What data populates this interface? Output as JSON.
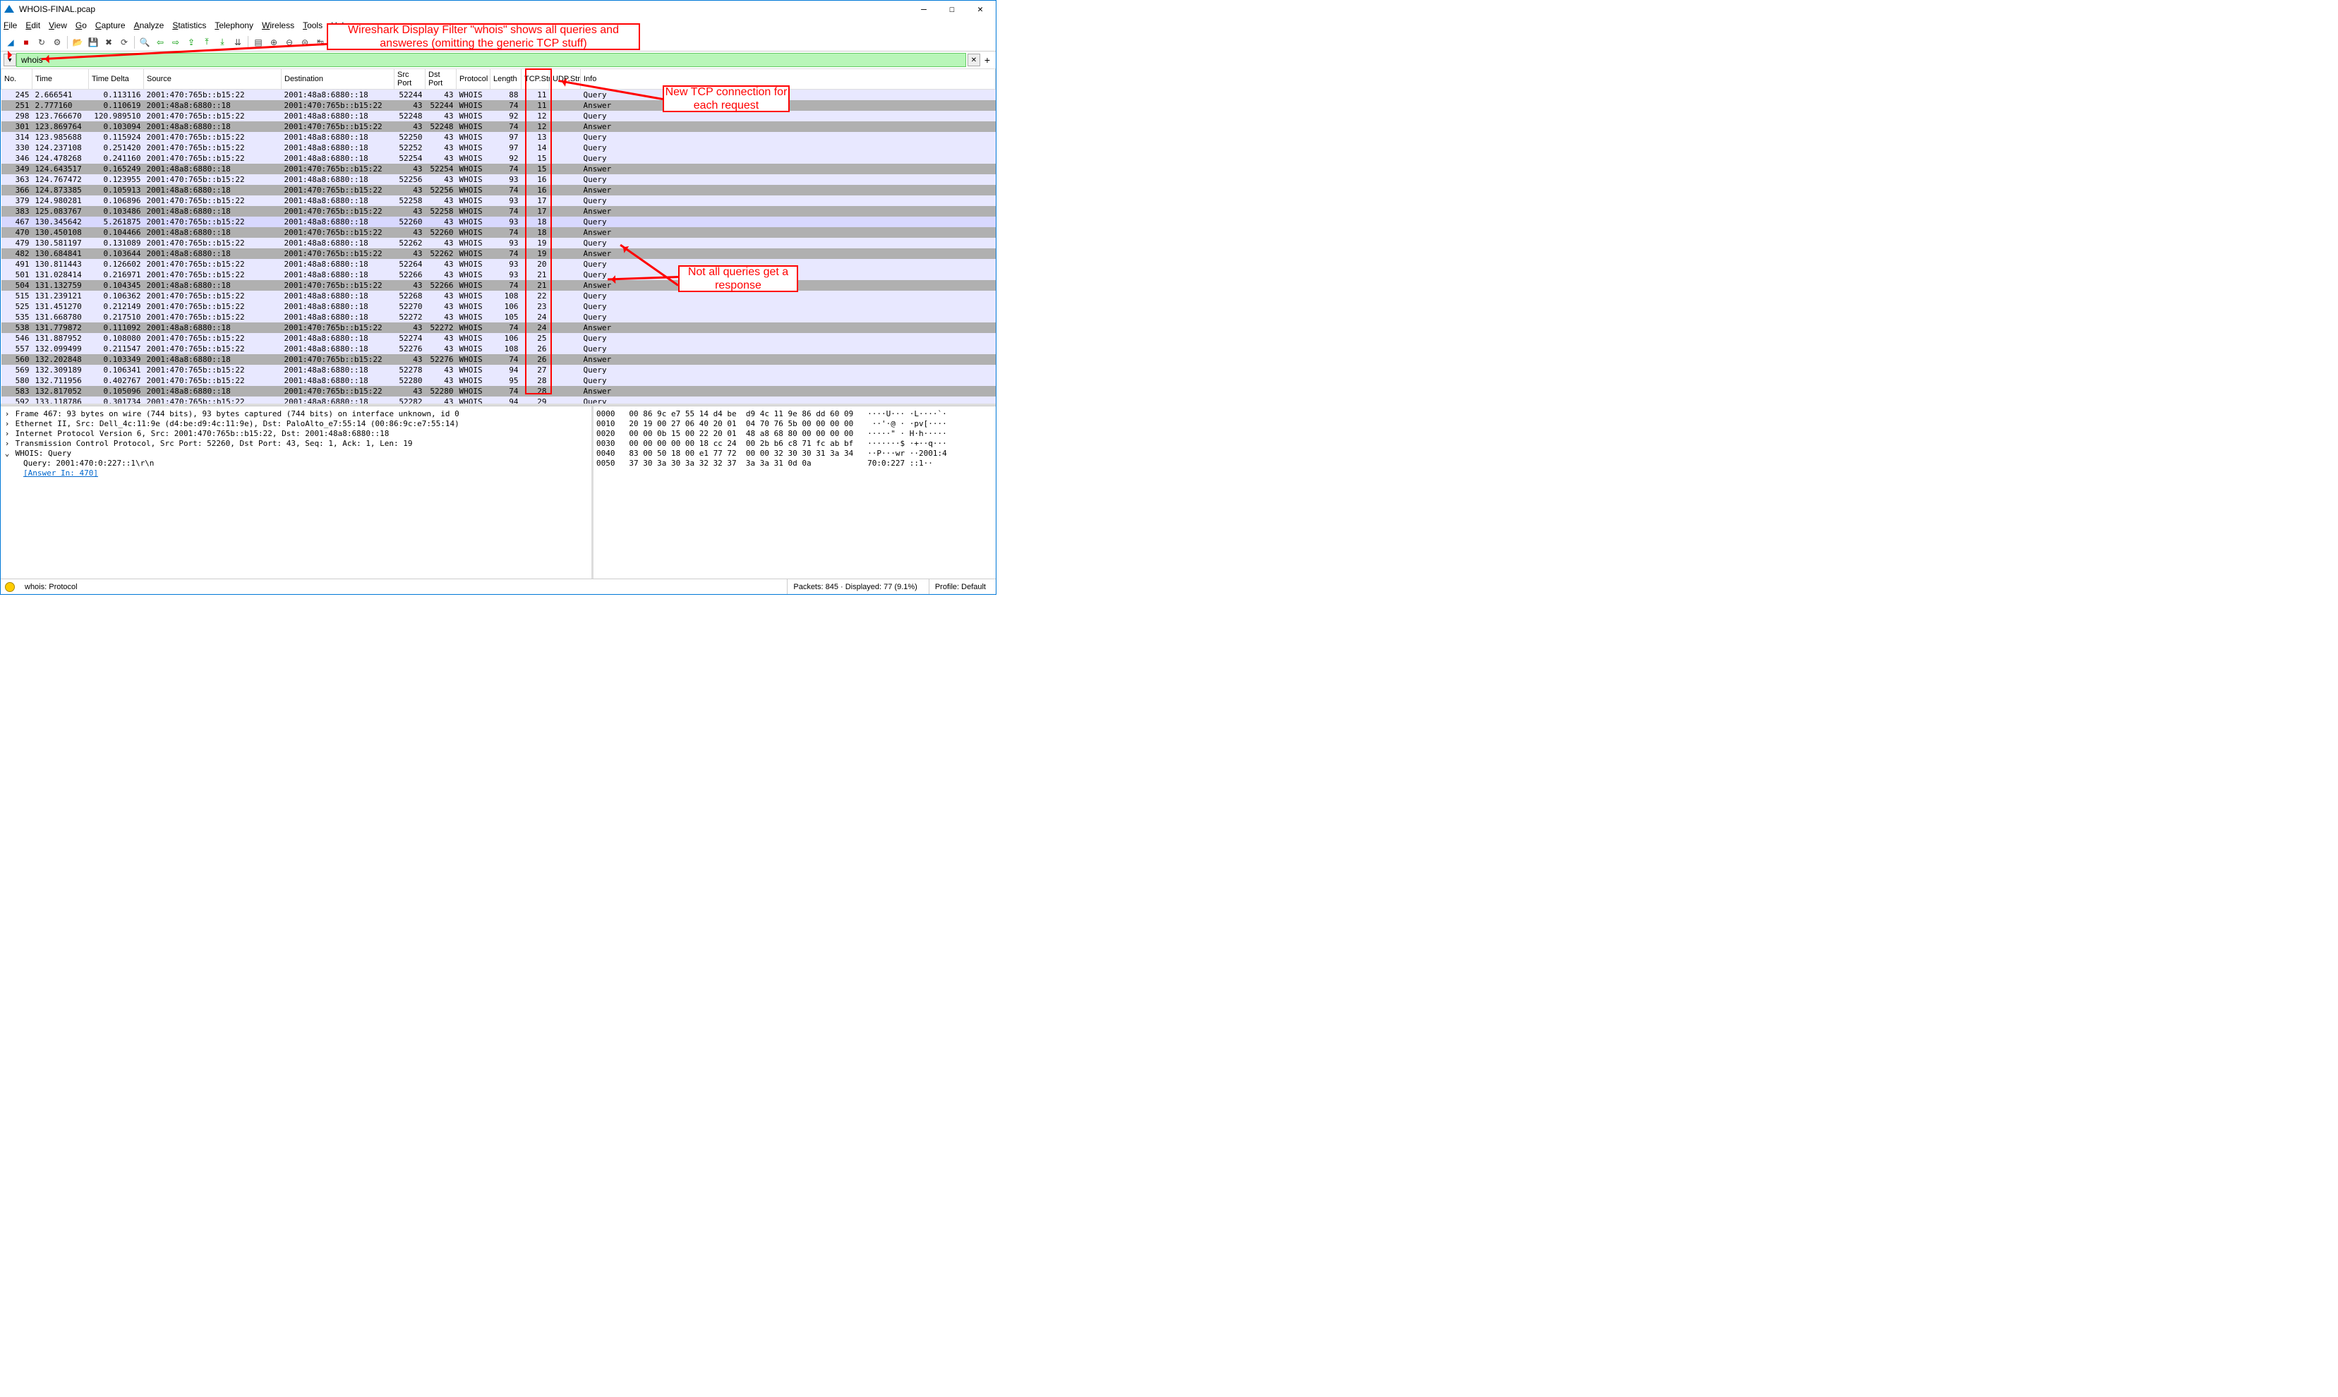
{
  "window": {
    "title": "WHOIS-FINAL.pcap"
  },
  "menu": [
    "File",
    "Edit",
    "View",
    "Go",
    "Capture",
    "Analyze",
    "Statistics",
    "Telephony",
    "Wireless",
    "Tools",
    "Help"
  ],
  "filter": {
    "value": "whois"
  },
  "columns": [
    "No.",
    "Time",
    "Time Delta",
    "Source",
    "Destination",
    "Src Port",
    "Dst Port",
    "Protocol",
    "Length",
    "TCP.Str",
    "UDP.Str",
    "Info"
  ],
  "rows": [
    {
      "no": "245",
      "time": "2.666541",
      "delta": "0.113116",
      "src": "2001:470:765b::b15:22",
      "dst": "2001:48a8:6880::18",
      "sp": "52244",
      "dp": "43",
      "proto": "WHOIS",
      "len": "88",
      "tcp": "11",
      "info": "Query",
      "type": "q"
    },
    {
      "no": "251",
      "time": "2.777160",
      "delta": "0.110619",
      "src": "2001:48a8:6880::18",
      "dst": "2001:470:765b::b15:22",
      "sp": "43",
      "dp": "52244",
      "proto": "WHOIS",
      "len": "74",
      "tcp": "11",
      "info": "Answer",
      "type": "a"
    },
    {
      "no": "298",
      "time": "123.766670",
      "delta": "120.989510",
      "src": "2001:470:765b::b15:22",
      "dst": "2001:48a8:6880::18",
      "sp": "52248",
      "dp": "43",
      "proto": "WHOIS",
      "len": "92",
      "tcp": "12",
      "info": "Query",
      "type": "q"
    },
    {
      "no": "301",
      "time": "123.869764",
      "delta": "0.103094",
      "src": "2001:48a8:6880::18",
      "dst": "2001:470:765b::b15:22",
      "sp": "43",
      "dp": "52248",
      "proto": "WHOIS",
      "len": "74",
      "tcp": "12",
      "info": "Answer",
      "type": "a"
    },
    {
      "no": "314",
      "time": "123.985688",
      "delta": "0.115924",
      "src": "2001:470:765b::b15:22",
      "dst": "2001:48a8:6880::18",
      "sp": "52250",
      "dp": "43",
      "proto": "WHOIS",
      "len": "97",
      "tcp": "13",
      "info": "Query",
      "type": "q"
    },
    {
      "no": "330",
      "time": "124.237108",
      "delta": "0.251420",
      "src": "2001:470:765b::b15:22",
      "dst": "2001:48a8:6880::18",
      "sp": "52252",
      "dp": "43",
      "proto": "WHOIS",
      "len": "97",
      "tcp": "14",
      "info": "Query",
      "type": "q"
    },
    {
      "no": "346",
      "time": "124.478268",
      "delta": "0.241160",
      "src": "2001:470:765b::b15:22",
      "dst": "2001:48a8:6880::18",
      "sp": "52254",
      "dp": "43",
      "proto": "WHOIS",
      "len": "92",
      "tcp": "15",
      "info": "Query",
      "type": "q"
    },
    {
      "no": "349",
      "time": "124.643517",
      "delta": "0.165249",
      "src": "2001:48a8:6880::18",
      "dst": "2001:470:765b::b15:22",
      "sp": "43",
      "dp": "52254",
      "proto": "WHOIS",
      "len": "74",
      "tcp": "15",
      "info": "Answer",
      "type": "a"
    },
    {
      "no": "363",
      "time": "124.767472",
      "delta": "0.123955",
      "src": "2001:470:765b::b15:22",
      "dst": "2001:48a8:6880::18",
      "sp": "52256",
      "dp": "43",
      "proto": "WHOIS",
      "len": "93",
      "tcp": "16",
      "info": "Query",
      "type": "q"
    },
    {
      "no": "366",
      "time": "124.873385",
      "delta": "0.105913",
      "src": "2001:48a8:6880::18",
      "dst": "2001:470:765b::b15:22",
      "sp": "43",
      "dp": "52256",
      "proto": "WHOIS",
      "len": "74",
      "tcp": "16",
      "info": "Answer",
      "type": "a"
    },
    {
      "no": "379",
      "time": "124.980281",
      "delta": "0.106896",
      "src": "2001:470:765b::b15:22",
      "dst": "2001:48a8:6880::18",
      "sp": "52258",
      "dp": "43",
      "proto": "WHOIS",
      "len": "93",
      "tcp": "17",
      "info": "Query",
      "type": "q"
    },
    {
      "no": "383",
      "time": "125.083767",
      "delta": "0.103486",
      "src": "2001:48a8:6880::18",
      "dst": "2001:470:765b::b15:22",
      "sp": "43",
      "dp": "52258",
      "proto": "WHOIS",
      "len": "74",
      "tcp": "17",
      "info": "Answer",
      "type": "a"
    },
    {
      "no": "467",
      "time": "130.345642",
      "delta": "5.261875",
      "src": "2001:470:765b::b15:22",
      "dst": "2001:48a8:6880::18",
      "sp": "52260",
      "dp": "43",
      "proto": "WHOIS",
      "len": "93",
      "tcp": "18",
      "info": "Query",
      "type": "sel"
    },
    {
      "no": "470",
      "time": "130.450108",
      "delta": "0.104466",
      "src": "2001:48a8:6880::18",
      "dst": "2001:470:765b::b15:22",
      "sp": "43",
      "dp": "52260",
      "proto": "WHOIS",
      "len": "74",
      "tcp": "18",
      "info": "Answer",
      "type": "a"
    },
    {
      "no": "479",
      "time": "130.581197",
      "delta": "0.131089",
      "src": "2001:470:765b::b15:22",
      "dst": "2001:48a8:6880::18",
      "sp": "52262",
      "dp": "43",
      "proto": "WHOIS",
      "len": "93",
      "tcp": "19",
      "info": "Query",
      "type": "q"
    },
    {
      "no": "482",
      "time": "130.684841",
      "delta": "0.103644",
      "src": "2001:48a8:6880::18",
      "dst": "2001:470:765b::b15:22",
      "sp": "43",
      "dp": "52262",
      "proto": "WHOIS",
      "len": "74",
      "tcp": "19",
      "info": "Answer",
      "type": "a"
    },
    {
      "no": "491",
      "time": "130.811443",
      "delta": "0.126602",
      "src": "2001:470:765b::b15:22",
      "dst": "2001:48a8:6880::18",
      "sp": "52264",
      "dp": "43",
      "proto": "WHOIS",
      "len": "93",
      "tcp": "20",
      "info": "Query",
      "type": "q"
    },
    {
      "no": "501",
      "time": "131.028414",
      "delta": "0.216971",
      "src": "2001:470:765b::b15:22",
      "dst": "2001:48a8:6880::18",
      "sp": "52266",
      "dp": "43",
      "proto": "WHOIS",
      "len": "93",
      "tcp": "21",
      "info": "Query",
      "type": "q"
    },
    {
      "no": "504",
      "time": "131.132759",
      "delta": "0.104345",
      "src": "2001:48a8:6880::18",
      "dst": "2001:470:765b::b15:22",
      "sp": "43",
      "dp": "52266",
      "proto": "WHOIS",
      "len": "74",
      "tcp": "21",
      "info": "Answer",
      "type": "a"
    },
    {
      "no": "515",
      "time": "131.239121",
      "delta": "0.106362",
      "src": "2001:470:765b::b15:22",
      "dst": "2001:48a8:6880::18",
      "sp": "52268",
      "dp": "43",
      "proto": "WHOIS",
      "len": "108",
      "tcp": "22",
      "info": "Query",
      "type": "q"
    },
    {
      "no": "525",
      "time": "131.451270",
      "delta": "0.212149",
      "src": "2001:470:765b::b15:22",
      "dst": "2001:48a8:6880::18",
      "sp": "52270",
      "dp": "43",
      "proto": "WHOIS",
      "len": "106",
      "tcp": "23",
      "info": "Query",
      "type": "q"
    },
    {
      "no": "535",
      "time": "131.668780",
      "delta": "0.217510",
      "src": "2001:470:765b::b15:22",
      "dst": "2001:48a8:6880::18",
      "sp": "52272",
      "dp": "43",
      "proto": "WHOIS",
      "len": "105",
      "tcp": "24",
      "info": "Query",
      "type": "q"
    },
    {
      "no": "538",
      "time": "131.779872",
      "delta": "0.111092",
      "src": "2001:48a8:6880::18",
      "dst": "2001:470:765b::b15:22",
      "sp": "43",
      "dp": "52272",
      "proto": "WHOIS",
      "len": "74",
      "tcp": "24",
      "info": "Answer",
      "type": "a"
    },
    {
      "no": "546",
      "time": "131.887952",
      "delta": "0.108080",
      "src": "2001:470:765b::b15:22",
      "dst": "2001:48a8:6880::18",
      "sp": "52274",
      "dp": "43",
      "proto": "WHOIS",
      "len": "106",
      "tcp": "25",
      "info": "Query",
      "type": "q"
    },
    {
      "no": "557",
      "time": "132.099499",
      "delta": "0.211547",
      "src": "2001:470:765b::b15:22",
      "dst": "2001:48a8:6880::18",
      "sp": "52276",
      "dp": "43",
      "proto": "WHOIS",
      "len": "108",
      "tcp": "26",
      "info": "Query",
      "type": "q"
    },
    {
      "no": "560",
      "time": "132.202848",
      "delta": "0.103349",
      "src": "2001:48a8:6880::18",
      "dst": "2001:470:765b::b15:22",
      "sp": "43",
      "dp": "52276",
      "proto": "WHOIS",
      "len": "74",
      "tcp": "26",
      "info": "Answer",
      "type": "a"
    },
    {
      "no": "569",
      "time": "132.309189",
      "delta": "0.106341",
      "src": "2001:470:765b::b15:22",
      "dst": "2001:48a8:6880::18",
      "sp": "52278",
      "dp": "43",
      "proto": "WHOIS",
      "len": "94",
      "tcp": "27",
      "info": "Query",
      "type": "q"
    },
    {
      "no": "580",
      "time": "132.711956",
      "delta": "0.402767",
      "src": "2001:470:765b::b15:22",
      "dst": "2001:48a8:6880::18",
      "sp": "52280",
      "dp": "43",
      "proto": "WHOIS",
      "len": "95",
      "tcp": "28",
      "info": "Query",
      "type": "q"
    },
    {
      "no": "583",
      "time": "132.817052",
      "delta": "0.105096",
      "src": "2001:48a8:6880::18",
      "dst": "2001:470:765b::b15:22",
      "sp": "43",
      "dp": "52280",
      "proto": "WHOIS",
      "len": "74",
      "tcp": "28",
      "info": "Answer",
      "type": "a"
    },
    {
      "no": "592",
      "time": "133.118786",
      "delta": "0.301734",
      "src": "2001:470:765b::b15:22",
      "dst": "2001:48a8:6880::18",
      "sp": "52282",
      "dp": "43",
      "proto": "WHOIS",
      "len": "94",
      "tcp": "29",
      "info": "Query",
      "type": "q"
    }
  ],
  "tree": [
    {
      "toggle": ">",
      "text": "Frame 467: 93 bytes on wire (744 bits), 93 bytes captured (744 bits) on interface unknown, id 0"
    },
    {
      "toggle": ">",
      "text": "Ethernet II, Src: Dell_4c:11:9e (d4:be:d9:4c:11:9e), Dst: PaloAlto_e7:55:14 (00:86:9c:e7:55:14)"
    },
    {
      "toggle": ">",
      "text": "Internet Protocol Version 6, Src: 2001:470:765b::b15:22, Dst: 2001:48a8:6880::18"
    },
    {
      "toggle": ">",
      "text": "Transmission Control Protocol, Src Port: 52260, Dst Port: 43, Seq: 1, Ack: 1, Len: 19"
    },
    {
      "toggle": "v",
      "text": "WHOIS: Query"
    },
    {
      "indent": true,
      "text": "Query: 2001:470:0:227::1\\r\\n"
    },
    {
      "indent": true,
      "link": true,
      "text": "[Answer In: 470]"
    }
  ],
  "hex": {
    "lines": [
      {
        "off": "0000",
        "hex": "00 86 9c e7 55 14 d4 be  d9 4c 11 9e 86 dd 60 09",
        "asc": "····U··· ·L····`·"
      },
      {
        "off": "0010",
        "hex": "20 19 00 27 06 40 20 01  04 70 76 5b 00 00 00 00",
        "asc": " ··'·@ · ·pv[····"
      },
      {
        "off": "0020",
        "hex": "00 00 0b 15 00 22 20 01  48 a8 68 80 00 00 00 00",
        "asc": "·····\" · H·h·····"
      },
      {
        "off": "0030",
        "hex": "00 00 00 00 00 18 cc 24  00 2b b6 c8 71 fc ab bf",
        "asc": "·······$ ·+··q···"
      },
      {
        "off": "0040",
        "hex": "83 00 50 18 00 e1 77 72  00 00 32 30 30 31 3a 34",
        "asc": "··P···wr ··2001:4"
      },
      {
        "off": "0050",
        "hex": "37 30 3a 30 3a 32 32 37  3a 3a 31 0d 0a         ",
        "asc": "70:0:227 ::1··"
      }
    ]
  },
  "status": {
    "field1": "whois: Protocol",
    "packets": "Packets: 845 · Displayed: 77 (9.1%)",
    "profile": "Profile: Default"
  },
  "annotations": {
    "box1": "Wireshark Display Filter \"whois\" shows all queries\nand answeres (omitting the generic TCP stuff)",
    "box2": "New TCP connection\nfor each request",
    "box3": "Not all queries get\na response"
  }
}
